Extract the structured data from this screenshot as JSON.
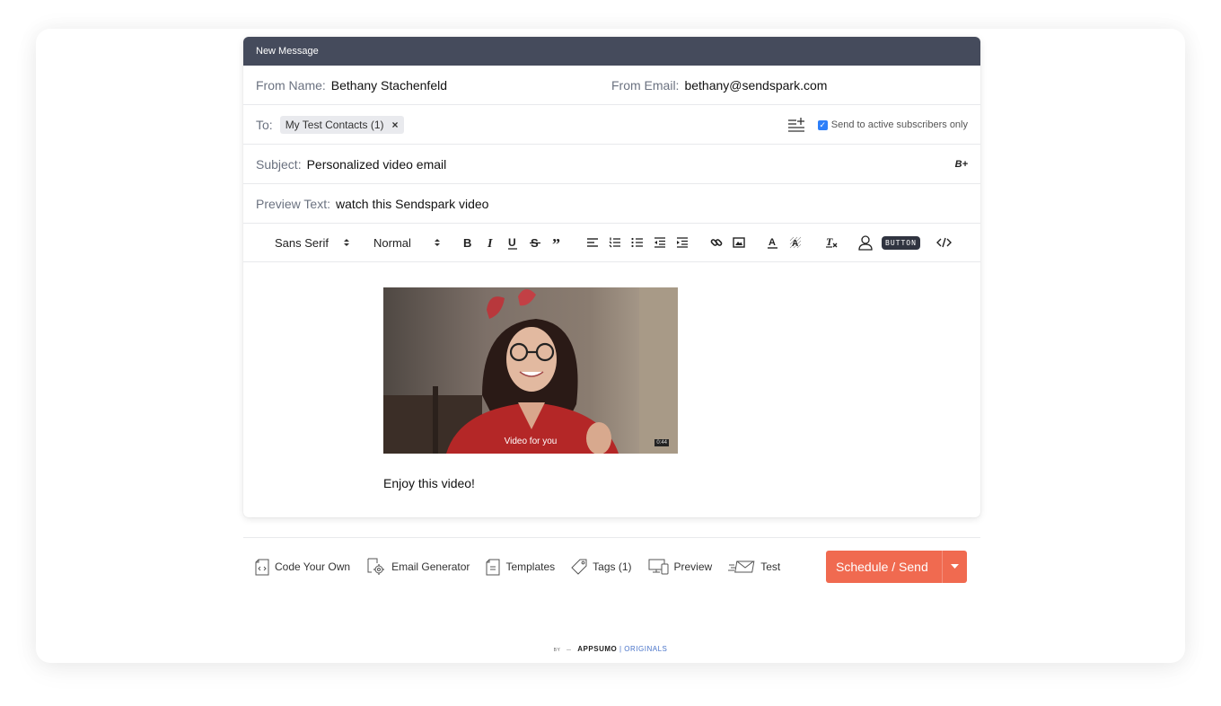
{
  "window": {
    "title": "New Message"
  },
  "from": {
    "name_label": "From Name:",
    "name_value": "Bethany Stachenfeld",
    "email_label": "From Email:",
    "email_value": "bethany@sendspark.com"
  },
  "to": {
    "label": "To:",
    "chip": "My Test Contacts (1)",
    "chip_remove": "×",
    "checkbox_label": "Send to active subscribers only",
    "checkbox_checked": true
  },
  "subject": {
    "label": "Subject:",
    "value": "Personalized video email",
    "personalize": "B+"
  },
  "preview_text": {
    "label": "Preview Text:",
    "value": "watch this Sendspark video"
  },
  "toolbar": {
    "font_select": "Sans Serif",
    "size_select": "Normal",
    "button_label": "BUTTON"
  },
  "editor": {
    "video_caption": "Video for you",
    "video_duration": "0:44",
    "body_text": "Enjoy this video!"
  },
  "actions": {
    "code_your_own": "Code Your Own",
    "email_generator": "Email Generator",
    "templates": "Templates",
    "tags": "Tags (1)",
    "preview": "Preview",
    "test": "Test",
    "send": "Schedule / Send"
  },
  "footer": {
    "by": "BY",
    "brand": "APPSUMO",
    "separator": "|",
    "suffix": "ORIGINALS"
  },
  "colors": {
    "titlebar": "#454b5c",
    "send_button": "#f06a50",
    "checkbox": "#2d7ff9",
    "footer_accent": "#4a74c9"
  }
}
